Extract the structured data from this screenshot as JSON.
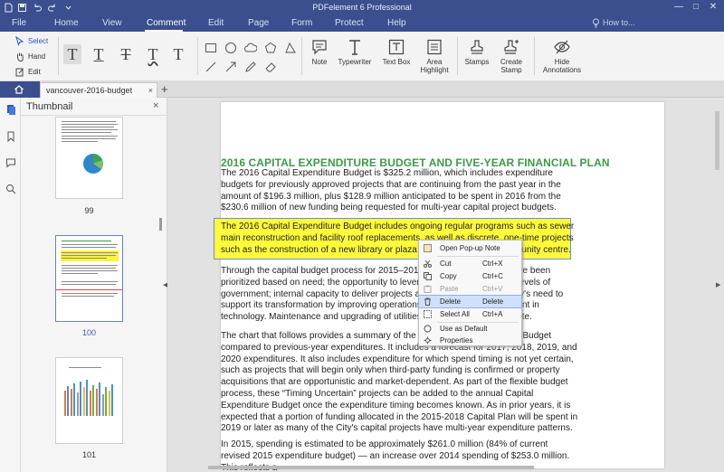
{
  "titlebar": {
    "app_title": "PDFelement 6 Professional",
    "window_buttons": {
      "minimize": "—",
      "maximize": "□",
      "close": "✕"
    }
  },
  "menubar": {
    "items": [
      "File",
      "Home",
      "View",
      "Comment",
      "Edit",
      "Page",
      "Form",
      "Protect",
      "Help"
    ],
    "active": "Comment",
    "howto": "How to..."
  },
  "ribbon": {
    "select_tools": [
      "Select",
      "Hand",
      "Edit"
    ],
    "text_tools": [
      "T",
      "T",
      "T",
      "T",
      "T"
    ],
    "big_tools": [
      {
        "label": "Note"
      },
      {
        "label": "Typewriter"
      },
      {
        "label": "Text Box"
      },
      {
        "label": "Area\nHighlight"
      },
      {
        "label": "Stamps"
      },
      {
        "label": "Create\nStamp"
      },
      {
        "label": "Hide\nAnnotations"
      }
    ]
  },
  "tabs": {
    "document": "vancouver-2016-budget",
    "close": "×",
    "add": "+"
  },
  "thumbnails": {
    "title": "Thumbnail",
    "close": "×",
    "pages": [
      "99",
      "100",
      "101"
    ],
    "selected": "100"
  },
  "document": {
    "heading": "2016 CAPITAL EXPENDITURE BUDGET AND FIVE-YEAR FINANCIAL PLAN",
    "para1": "The 2016 Capital Expenditure Budget is $325.2 million, which includes expenditure budgets for previously approved projects that are continuing from the past year in the amount of $196.3 million, plus $128.9 million anticipated to be spent in 2016 from the $230.6 million of new funding being requested for multi-year capital project budgets.",
    "para2_highlighted": "The 2016 Capital Expenditure Budget includes ongoing regular programs such as sewer main reconstruction and facility roof replacements, as well as discrete, one-time projects such as the construction of a new library or plaza or the renewal of a community centre.",
    "para3": "Through the capital budget process for 2015–2018, capital investments have been prioritized based on need; the opportunity to leverage funding from senior levels of government; internal capacity to deliver projects and programs; and the City's need to support its transformation by improving operations through capital investment in technology. Maintenance and upgrading of utilities remains a critical mandate.",
    "para4": "The chart that follows provides a summary of the 2016 Capital Expenditure Budget compared to previous-year expenditures. It includes a forecast for 2017, 2018, 2019, and 2020 expenditures. It also includes expenditure for which spend timing is not yet certain, such as projects that will begin only when third-party funding is confirmed or property acquisitions that are opportunistic and market-dependent. As part of the flexible budget process, these “Timing Uncertain” projects can be added to the annual Capital Expenditure Budget once the expenditure timing becomes known. As in prior years, it is expected that a portion of funding allocated in the 2015-2018 Capital Plan will be spent in 2019 or later as many of the City's capital projects have multi-year expenditure patterns.",
    "para5": "In 2015, spending is estimated to be approximately $261.0 million (84% of current revised 2015 expenditure budget) — an increase over 2014 spending of $253.0 million. This reflects a"
  },
  "context_menu": {
    "items": [
      {
        "label": "Open Pop-up Note",
        "shortcut": "",
        "icon": "note-icon"
      },
      {
        "label": "Cut",
        "shortcut": "Ctrl+X",
        "icon": "scissors-icon"
      },
      {
        "label": "Copy",
        "shortcut": "Ctrl+C",
        "icon": "copy-icon"
      },
      {
        "label": "Paste",
        "shortcut": "Ctrl+V",
        "icon": "paste-icon"
      },
      {
        "label": "Delete",
        "shortcut": "Delete",
        "icon": "trash-icon"
      },
      {
        "label": "Select All",
        "shortcut": "Ctrl+A",
        "icon": "select-all-icon"
      },
      {
        "label": "Use as Default",
        "shortcut": "",
        "icon": "default-icon"
      },
      {
        "label": "Properties",
        "shortcut": "",
        "icon": "gear-icon"
      }
    ],
    "hovered": "Delete",
    "disabled": "Paste"
  },
  "colors": {
    "chrome": "#3b4f8e",
    "heading": "#3d9a48",
    "highlight": "#fffb3a",
    "selection": "#6a7fd0"
  }
}
